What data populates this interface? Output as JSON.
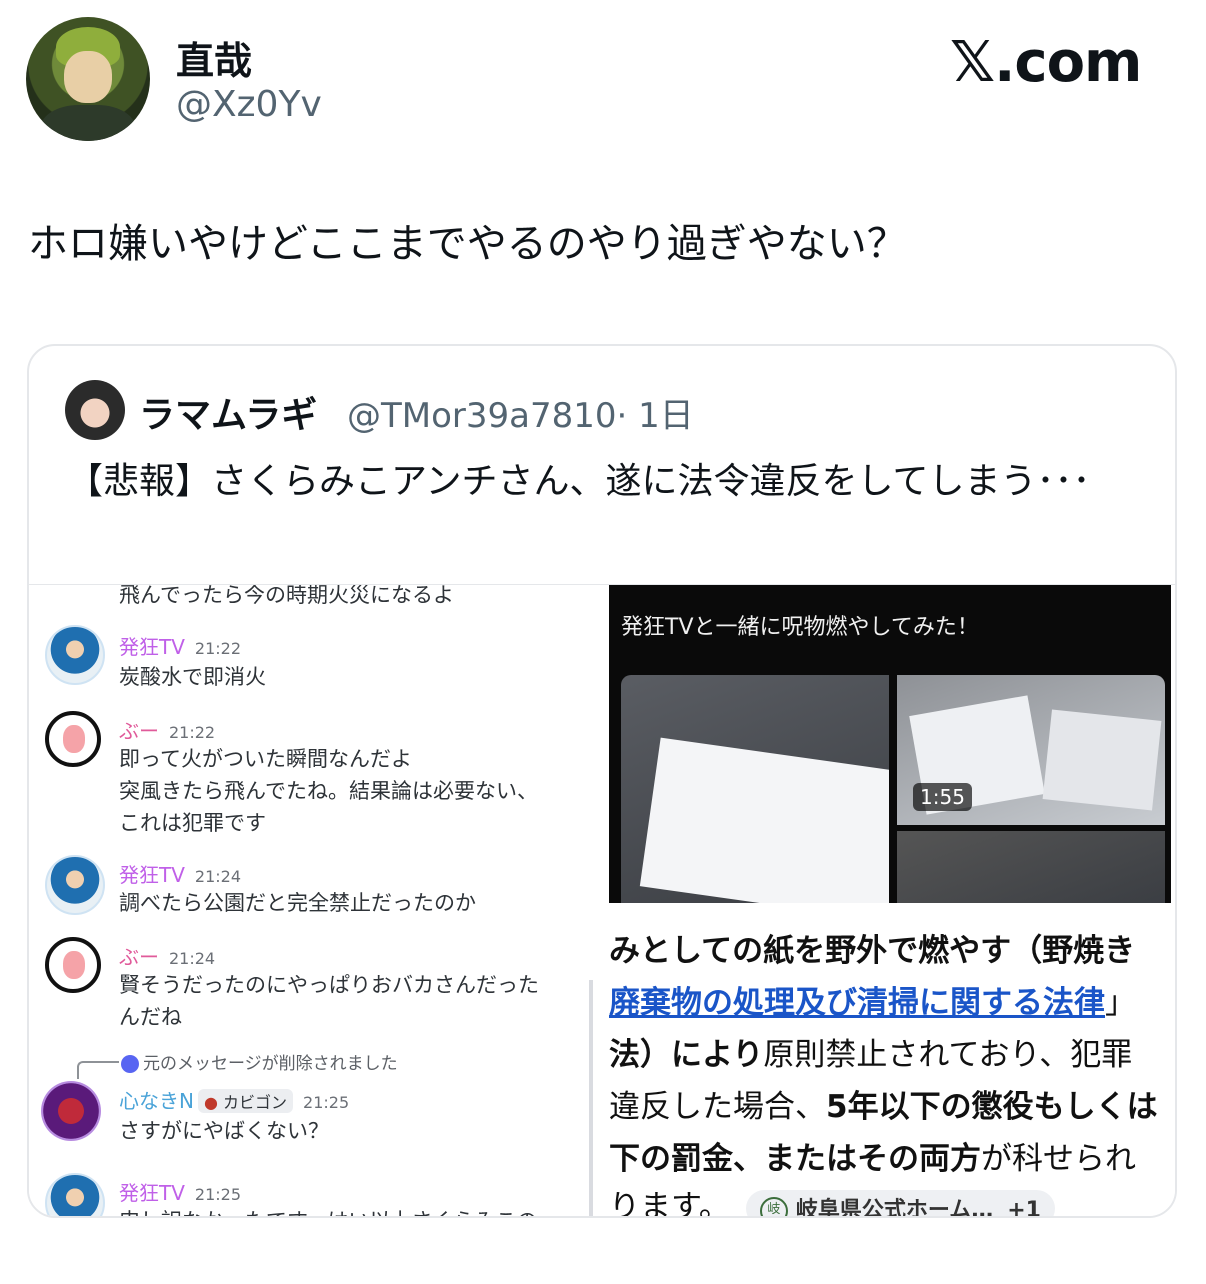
{
  "author": {
    "name": "直哉",
    "handle": "@Xz0Yv"
  },
  "brand": "𝕏.com",
  "tweet_text": "ホロ嫌いやけどここまでやるのやり過ぎやない？",
  "quote": {
    "name": "ラマムラギ",
    "handle": "@TMor39a7810",
    "age": "· 1日",
    "text": "【悲報】さくらみこアンチさん、遂に法令違反をしてしまう･･･"
  },
  "chat": {
    "top_cut": "飛んでったら今の時期火災になるよ",
    "messages": [
      {
        "user": "発狂TV",
        "time": "21:22",
        "lines": [
          "炭酸水で即消火"
        ]
      },
      {
        "user": "ぶー",
        "time": "21:22",
        "lines": [
          "即って火がついた瞬間なんだよ",
          "突風きたら飛んでたね。結果論は必要ない、",
          "これは犯罪です"
        ]
      },
      {
        "user": "発狂TV",
        "time": "21:24",
        "lines": [
          "調べたら公園だと完全禁止だったのか"
        ]
      },
      {
        "user": "ぶー",
        "time": "21:24",
        "lines": [
          "賢そうだったのにやっぱりおバカさんだった",
          "んだね"
        ]
      },
      {
        "user": "心なきN",
        "time": "21:25",
        "tag": "カビゴン",
        "reply_note": "元のメッセージが削除されました",
        "lines": [
          "さすがにやばくない？"
        ]
      },
      {
        "user": "発狂TV",
        "time": "21:25",
        "lines": [
          "申し訳なかったです、はい以上さくらみこの"
        ]
      }
    ]
  },
  "video": {
    "title": "発狂TVと一緒に呪物燃やしてみた！",
    "duration": "1:55"
  },
  "article": {
    "l1": "みとしての紙を野外で燃やす（野焼き",
    "l2_link": "廃棄物の処理及び清掃に関する法律",
    "l2_tail": "」",
    "l3_bold": "法）により",
    "l3_rest": "原則禁止されており、犯罪",
    "l4_a": "違反した場合、",
    "l4_bold": "5年以下の懲役もしくは",
    "l5_bold": "下の罰金、またはその両方",
    "l5_rest": "が科せられ",
    "l6": "ります。",
    "source_icon": "岐",
    "source": "岐阜県公式ホーム…",
    "source_more": "+1"
  }
}
